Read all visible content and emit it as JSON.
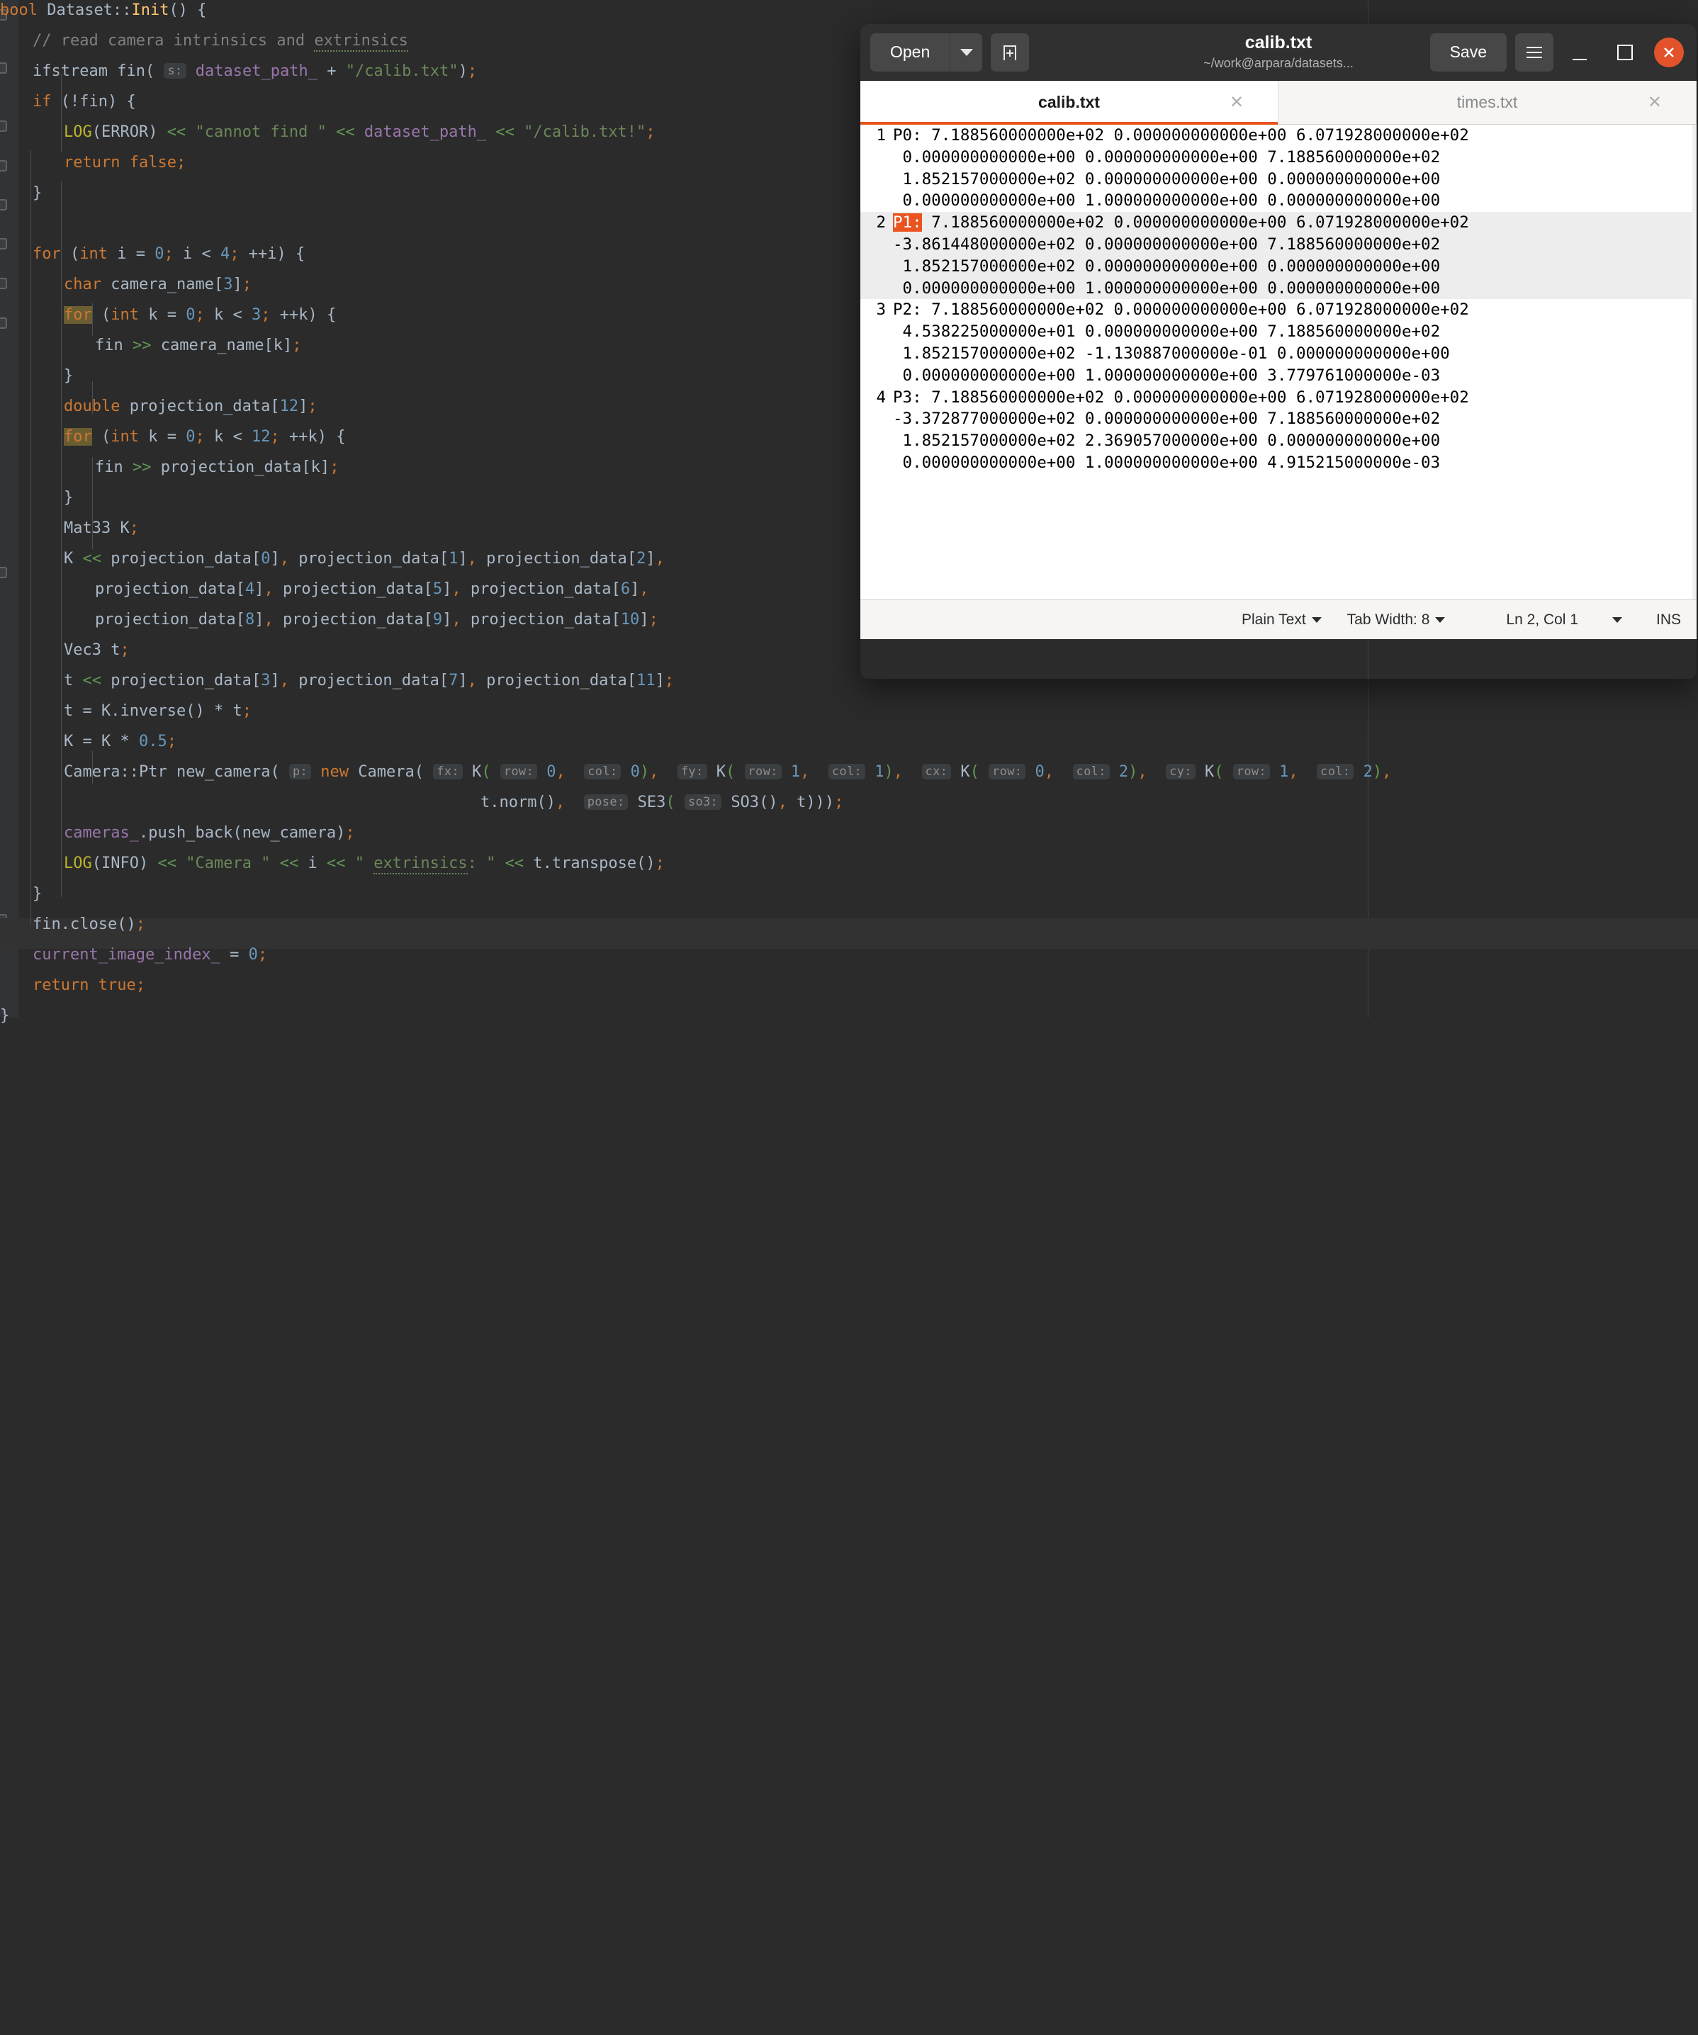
{
  "ide": {
    "name": "code-editor",
    "theme_bg": "#2b2b2b",
    "accent_keyword": "#cc7832",
    "code_lines": [
      "bool Dataset::Init() {",
      "    // read camera intrinsics and extrinsics",
      "    ifstream fin( s: dataset_path_ + \"/calib.txt\");",
      "    if (!fin) {",
      "        LOG(ERROR) << \"cannot find \" << dataset_path_ << \"/calib.txt!\";",
      "        return false;",
      "    }",
      "",
      "    for (int i = 0; i < 4; ++i) {",
      "        char camera_name[3];",
      "        for (int k = 0; k < 3; ++k) {",
      "            fin >> camera_name[k];",
      "        }",
      "        double projection_data[12];",
      "        for (int k = 0; k < 12; ++k) {",
      "            fin >> projection_data[k];",
      "        }",
      "        Mat33 K;",
      "        K << projection_data[0], projection_data[1], projection_data[2],",
      "            projection_data[4], projection_data[5], projection_data[6],",
      "            projection_data[8], projection_data[9], projection_data[10];",
      "        Vec3 t;",
      "        t << projection_data[3], projection_data[7], projection_data[11];",
      "        t = K.inverse() * t;",
      "        K = K * 0.5;",
      "        Camera::Ptr new_camera( p: new Camera( fx: K( row: 0,  col: 0),  fy: K( row: 1,  col: 1),  cx: K( row: 0,  col: 2),  cy: K( row: 1,  col: 2),",
      "                                t.norm(),  pose: SE3( so3: SO3(), t)));",
      "        cameras_.push_back(new_camera);",
      "        LOG(INFO) << \"Camera \" << i << \" extrinsics: \" << t.transpose();",
      "    }",
      "    fin.close();",
      "    current_image_index_ = 0;",
      "    return true;",
      "}"
    ],
    "search_match_token": "for",
    "inlay_hints": [
      "s:",
      "p:",
      "fx:",
      "row:",
      "col:",
      "fy:",
      "cx:",
      "cy:",
      "pose:",
      "so3:"
    ]
  },
  "gedit": {
    "window_title": "calib.txt",
    "window_subtitle": "~/work@arpara/datasets...",
    "buttons": {
      "open_label": "Open",
      "open_arrow_icon": "chevron-down-icon",
      "new_doc_icon": "new-document-icon",
      "save_label": "Save",
      "menu_icon": "hamburger-menu-icon",
      "minimize_icon": "minimize-icon",
      "maximize_icon": "maximize-icon",
      "close_icon": "close-icon"
    },
    "accent_color": "#e95420",
    "tabs": [
      {
        "label": "calib.txt",
        "active": true,
        "close_icon": "close-icon"
      },
      {
        "label": "times.txt",
        "active": false,
        "close_icon": "close-icon"
      }
    ],
    "document": {
      "lines": [
        {
          "number": "1",
          "prefix": "P0:",
          "prefix_selected": false,
          "highlight": false,
          "rows": [
            "P0: 7.188560000000e+02 0.000000000000e+00 6.071928000000e+02",
            " 0.000000000000e+00 0.000000000000e+00 7.188560000000e+02",
            " 1.852157000000e+02 0.000000000000e+00 0.000000000000e+00",
            " 0.000000000000e+00 1.000000000000e+00 0.000000000000e+00"
          ]
        },
        {
          "number": "2",
          "prefix": "P1:",
          "prefix_selected": true,
          "highlight": true,
          "rows": [
            " 7.188560000000e+02 0.000000000000e+00 6.071928000000e+02",
            "-3.861448000000e+02 0.000000000000e+00 7.188560000000e+02",
            " 1.852157000000e+02 0.000000000000e+00 0.000000000000e+00",
            " 0.000000000000e+00 1.000000000000e+00 0.000000000000e+00"
          ]
        },
        {
          "number": "3",
          "prefix": "P2:",
          "prefix_selected": false,
          "highlight": false,
          "rows": [
            "P2: 7.188560000000e+02 0.000000000000e+00 6.071928000000e+02",
            " 4.538225000000e+01 0.000000000000e+00 7.188560000000e+02",
            " 1.852157000000e+02 -1.130887000000e-01 0.000000000000e+00",
            " 0.000000000000e+00 1.000000000000e+00 3.779761000000e-03"
          ]
        },
        {
          "number": "4",
          "prefix": "P3:",
          "prefix_selected": false,
          "highlight": false,
          "rows": [
            "P3: 7.188560000000e+02 0.000000000000e+00 6.071928000000e+02",
            "-3.372877000000e+02 0.000000000000e+00 7.188560000000e+02",
            " 1.852157000000e+02 2.369057000000e+00 0.000000000000e+00",
            " 0.000000000000e+00 1.000000000000e+00 4.915215000000e-03"
          ]
        }
      ]
    },
    "status_bar": {
      "language": "Plain Text",
      "tab_width": "Tab Width: 8",
      "cursor_position": "Ln 2, Col 1",
      "insert_mode": "INS"
    }
  }
}
